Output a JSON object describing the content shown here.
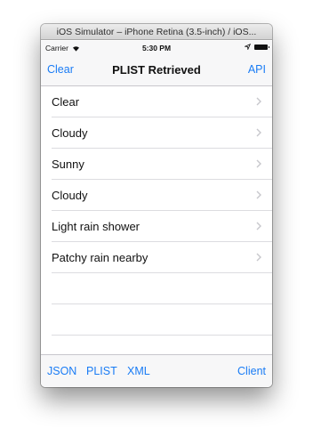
{
  "window": {
    "title": "iOS Simulator – iPhone Retina (3.5-inch) / iOS..."
  },
  "status_bar": {
    "carrier": "Carrier",
    "time": "5:30 PM"
  },
  "nav": {
    "left_button": "Clear",
    "title": "PLIST Retrieved",
    "right_button": "API"
  },
  "rows": [
    {
      "label": "Clear"
    },
    {
      "label": "Cloudy"
    },
    {
      "label": "Sunny"
    },
    {
      "label": "Cloudy"
    },
    {
      "label": "Light rain shower"
    },
    {
      "label": "Patchy rain nearby"
    }
  ],
  "toolbar": {
    "json": "JSON",
    "plist": "PLIST",
    "xml": "XML",
    "client": "Client"
  },
  "colors": {
    "tint": "#1a7cf5",
    "separator": "#dcdce0",
    "chevron": "#c7c7cc"
  }
}
